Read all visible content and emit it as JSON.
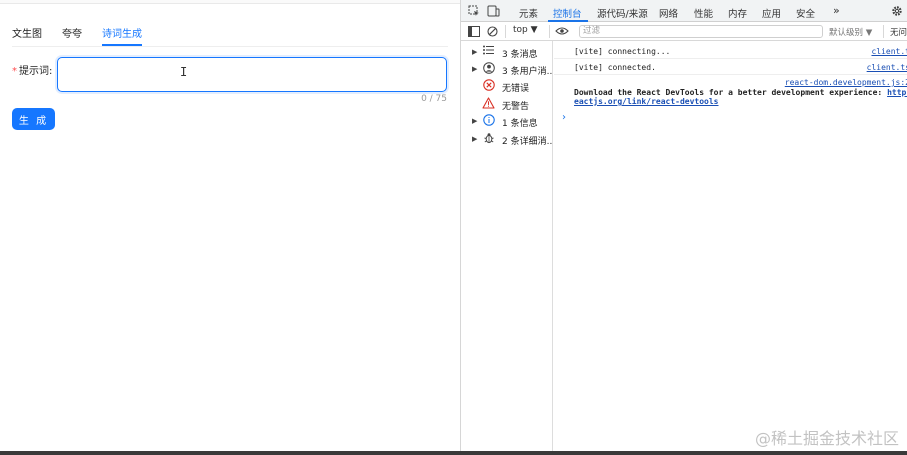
{
  "app": {
    "tabs": [
      {
        "label": "文生图"
      },
      {
        "label": "夸夸"
      },
      {
        "label": "诗词生成"
      }
    ],
    "active_tab_index": 2,
    "prompt": {
      "required_mark": "*",
      "label": "提示词:",
      "value": "",
      "counter": "0 / 75"
    },
    "generate_label": "生 成"
  },
  "devtools": {
    "tabs": [
      {
        "label": "元素"
      },
      {
        "label": "控制台"
      },
      {
        "label": "源代码/来源"
      },
      {
        "label": "网络"
      },
      {
        "label": "性能"
      },
      {
        "label": "内存"
      },
      {
        "label": "应用"
      },
      {
        "label": "安全"
      },
      {
        "label": "»"
      }
    ],
    "active_tab": "控制台",
    "toolbar": {
      "context": "top ▼",
      "filter_placeholder": "过滤",
      "level": "默认级别 ▼",
      "issues": "无问"
    },
    "sidebar": [
      {
        "label": "3 条消息",
        "icon": "list-icon",
        "has_arrow": true
      },
      {
        "label": "3 条用户消...",
        "icon": "user-icon",
        "has_arrow": true
      },
      {
        "label": "无错误",
        "icon": "error-icon",
        "has_arrow": false
      },
      {
        "label": "无警告",
        "icon": "warning-icon",
        "has_arrow": false
      },
      {
        "label": "1 条信息",
        "icon": "info-icon",
        "has_arrow": true
      },
      {
        "label": "2 条详细消...",
        "icon": "bug-icon",
        "has_arrow": true
      }
    ],
    "messages": [
      {
        "text": "[vite] connecting...",
        "source": "client.t"
      },
      {
        "text": "[vite] connected.",
        "source": "client.ts"
      },
      {
        "source": "react-dom.development.js:2",
        "text_line1": "Download the React DevTools for a better development experience: ",
        "link_part1": "https",
        "link_part2": "eactjs.org/link/react-devtools"
      }
    ],
    "prompt_glyph": "›"
  },
  "watermark": "@稀土掘金技术社区",
  "colors": {
    "accent": "#1677ff",
    "devtools_accent": "#1a73e8",
    "error": "#d93025",
    "warning": "#e37400"
  }
}
